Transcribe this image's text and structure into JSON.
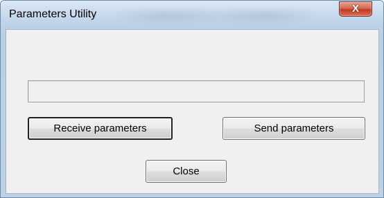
{
  "window": {
    "title": "Parameters Utility",
    "close_glyph": "X"
  },
  "status": {
    "value": ""
  },
  "buttons": {
    "receive_label": "Receive parameters",
    "send_label": "Send parameters",
    "close_label": "Close"
  },
  "colors": {
    "title_bar": "#c6d9ed",
    "close_button": "#c0391f",
    "client_background": "#f0f0f0"
  }
}
